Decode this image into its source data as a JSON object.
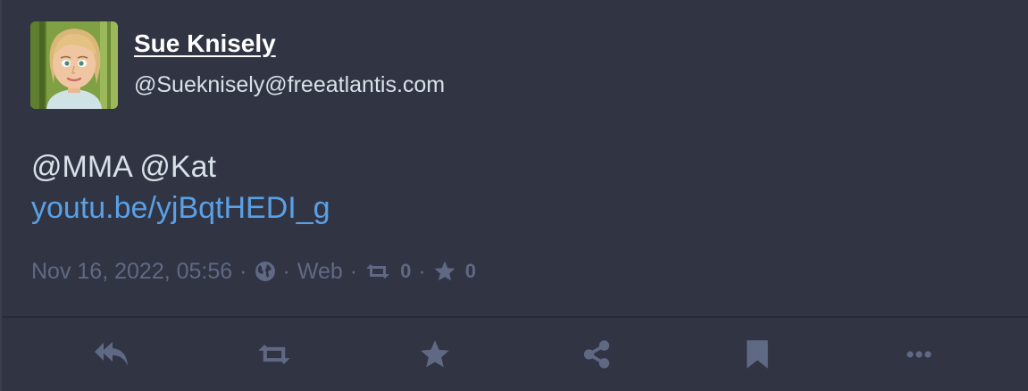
{
  "account": {
    "display_name": "Sue Knisely",
    "handle": "@Sueknisely@freeatlantis.com",
    "avatar_icon": "cartoon-woman-avatar"
  },
  "status": {
    "mentions": "@MMA @Kat",
    "link": "youtu.be/yjBqtHEDI_g"
  },
  "meta": {
    "timestamp": "Nov 16, 2022, 05:56",
    "visibility_icon": "globe-icon",
    "application": "Web",
    "boost_count": "0",
    "favourite_count": "0",
    "separator": "·"
  },
  "actions": [
    {
      "name": "reply-all-icon"
    },
    {
      "name": "boost-icon"
    },
    {
      "name": "favourite-star-icon"
    },
    {
      "name": "share-icon"
    },
    {
      "name": "bookmark-icon"
    },
    {
      "name": "more-icon"
    }
  ],
  "colors": {
    "background": "#313543",
    "text": "#d9e1e8",
    "link": "#5aa0e6",
    "muted": "#606984",
    "action_icon": "#606984"
  }
}
